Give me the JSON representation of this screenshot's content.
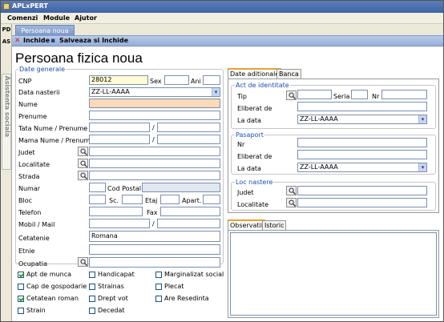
{
  "window": {
    "title": "APLxPERT"
  },
  "menu": {
    "items": [
      "Comenzi",
      "Module",
      "Ajutor"
    ]
  },
  "left_tabs": {
    "pd": "PD",
    "as": "AS",
    "vertical_tab": "Asistenta sociala"
  },
  "doc_tab": {
    "label": "Persoana noua"
  },
  "toolbar": {
    "close_label": "Inchide",
    "save_close_label": "Salveaza si Inchide"
  },
  "page": {
    "title": "Persoana fizica noua"
  },
  "date_generale": {
    "legend": "Date generale",
    "cnp_label": "CNP",
    "cnp_value": "28012",
    "sex_label": "Sex",
    "sex_value": "",
    "ani_label": "Ani",
    "ani_value": "",
    "data_nasterii_label": "Data nasterii",
    "data_nasterii_value": "ZZ-LL-AAAA",
    "nume_label": "Nume",
    "prenume_label": "Prenume",
    "tata_label": "Tata Nume / Prenume",
    "mama_label": "Mama Nume / Prenume",
    "slash": "/",
    "judet_label": "Judet",
    "localitate_label": "Localitate",
    "strada_label": "Strada",
    "numar_label": "Numar",
    "cod_postal_label": "Cod Postal",
    "bloc_label": "Bloc",
    "sc_label": "Sc.",
    "etaj_label": "Etaj",
    "apart_label": "Apart.",
    "telefon_label": "Telefon",
    "fax_label": "Fax",
    "mobil_label": "Mobil / Mail",
    "cetatenie_label": "Cetatenie",
    "cetatenie_value": "Romana",
    "etnie_label": "Etnie",
    "ocupatia_label": "Ocupatia"
  },
  "checkboxes": [
    {
      "label": "Apt de munca",
      "checked": true
    },
    {
      "label": "Handicapat",
      "checked": false
    },
    {
      "label": "Marginalizat social",
      "checked": false
    },
    {
      "label": "Cap de gospodarie",
      "checked": false
    },
    {
      "label": "Strainas",
      "checked": false
    },
    {
      "label": "Plecat",
      "checked": false
    },
    {
      "label": "Cetatean roman",
      "checked": true
    },
    {
      "label": "Drept vot",
      "checked": false
    },
    {
      "label": "Are Resedinta",
      "checked": false
    },
    {
      "label": "Strain",
      "checked": false
    },
    {
      "label": "Decedat",
      "checked": false
    }
  ],
  "right_tabs": {
    "tab1": "Date aditionale",
    "tab2": "Banca"
  },
  "act": {
    "legend": "Act de identitate",
    "tip_label": "Tip",
    "seria_label": "Seria",
    "nr_label": "Nr",
    "eliberat_label": "Eliberat de",
    "la_data_label": "La data",
    "la_data_value": "ZZ-LL-AAAA"
  },
  "pasaport": {
    "legend": "Pasaport",
    "nr_label": "Nr",
    "eliberat_label": "Eliberat de",
    "la_data_label": "La data",
    "la_data_value": "ZZ-LL-AAAA"
  },
  "loc_nastere": {
    "legend": "Loc nastere",
    "judet_label": "Judet",
    "localitate_label": "Localitate"
  },
  "bottom_tabs": {
    "tab1": "Observatii",
    "tab2": "Istoric"
  },
  "colors": {
    "accent_title": "#3f63a6",
    "legend_blue": "#1b4fb0",
    "required_field": "#fcd9b8",
    "cnp_field": "#fffbd5"
  }
}
